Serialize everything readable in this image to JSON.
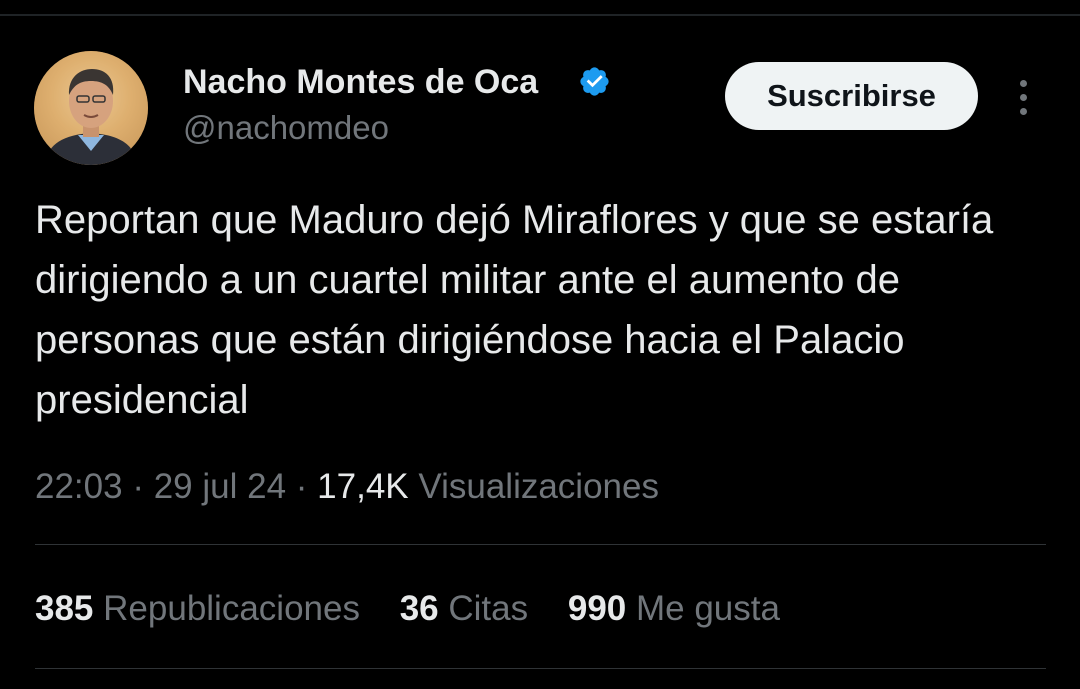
{
  "author": {
    "display_name": "Nacho Montes de Oca",
    "handle": "@nachomdeo",
    "verified_icon": "verified-badge-icon",
    "verified_color": "#1d9bf0"
  },
  "actions": {
    "subscribe_label": "Suscribirse",
    "more_icon": "more-vertical-icon"
  },
  "tweet": {
    "text": "Reportan que Maduro dejó Miraflores y que se estaría dirigiendo a un cuartel militar ante el aumento de personas que están dirigiéndose hacia el Palacio presidencial",
    "time": "22:03",
    "date": "29 jul 24",
    "separator": "·",
    "views_count": "17,4K",
    "views_label": "Visualizaciones"
  },
  "stats": {
    "reposts_count": "385",
    "reposts_label": "Republicaciones",
    "quotes_count": "36",
    "quotes_label": "Citas",
    "likes_count": "990",
    "likes_label": "Me gusta"
  },
  "colors": {
    "background": "#000000",
    "primary_text": "#e7e9ea",
    "secondary_text": "#71767b",
    "divider": "#2f3336"
  }
}
